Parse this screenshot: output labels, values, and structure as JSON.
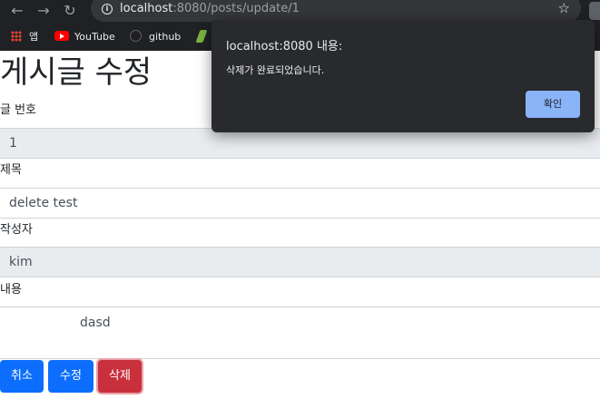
{
  "browser": {
    "back_icon": "←",
    "forward_icon": "→",
    "reload_icon": "↻",
    "info_icon": "i",
    "url_host": "localhost",
    "url_rest": ":8080/posts/update/1",
    "star_icon": "☆",
    "bookmarks": [
      {
        "label": "앱",
        "icon": "apps-grid-icon"
      },
      {
        "label": "YouTube",
        "icon": "youtube-icon"
      },
      {
        "label": "github",
        "icon": "github-icon"
      }
    ]
  },
  "page": {
    "title": "게시글 수정",
    "fields": {
      "id_label": "글 번호",
      "id_value": "1",
      "title_label": "제목",
      "title_value": "delete test",
      "author_label": "작성자",
      "author_value": "kim",
      "content_label": "내용",
      "content_value": "dasd"
    },
    "buttons": {
      "cancel": "취소",
      "edit": "수정",
      "delete": "삭제"
    }
  },
  "alert": {
    "title": "localhost:8080 내용:",
    "message": "삭제가 완료되었습니다.",
    "ok_label": "확인"
  },
  "colors": {
    "primary": "#0d6efd",
    "danger": "#c8303c",
    "dialog_bg": "#292a2d",
    "dialog_button": "#8ab4f8"
  }
}
